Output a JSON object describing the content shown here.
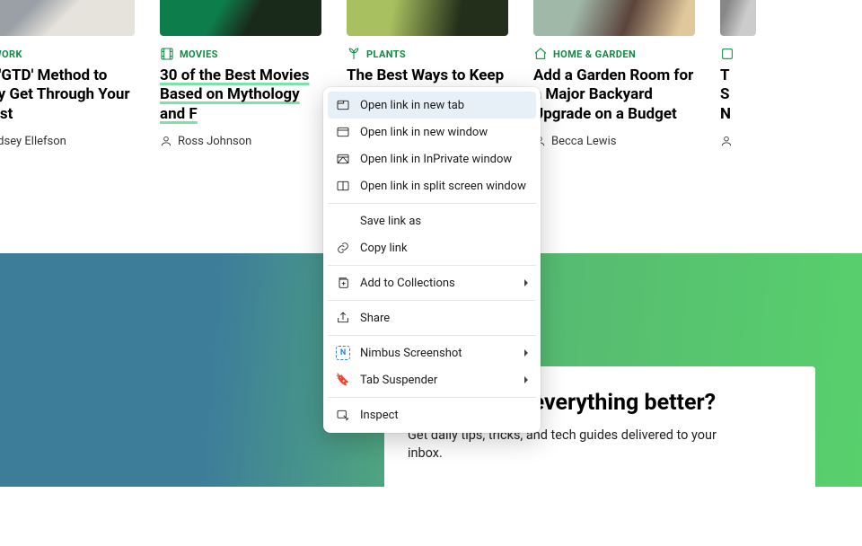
{
  "cards": [
    {
      "category": "WORK",
      "title": "the 'GTD' Method to ually Get Through Your To-ist",
      "author": "ndsey Ellefson",
      "underline": false
    },
    {
      "category": "MOVIES",
      "title": "30 of the Best Movies Based on Mythology and F",
      "author": "Ross Johnson",
      "underline": true
    },
    {
      "category": "PLANTS",
      "title": "The Best Ways to Keep                                       r Potted",
      "author": "",
      "underline": false
    },
    {
      "category": "HOME & GARDEN",
      "title": "Add a Garden Room for a Major Backyard Upgrade on a Budget",
      "author": "Becca Lewis",
      "underline": false
    },
    {
      "category": "",
      "title": "T\nS\nN",
      "author": "",
      "underline": false
    }
  ],
  "subscribe": {
    "title": "Ready to do everything better?",
    "sub": "Get daily tips, tricks, and tech guides delivered to your inbox."
  },
  "context_menu": {
    "items": [
      {
        "id": "open-new-tab",
        "label": "Open link in new tab",
        "hover": true,
        "icon": "tab",
        "submenu": false
      },
      {
        "id": "open-new-window",
        "label": "Open link in new window",
        "hover": false,
        "icon": "window",
        "submenu": false
      },
      {
        "id": "open-inprivate",
        "label": "Open link in InPrivate window",
        "hover": false,
        "icon": "inprivate",
        "submenu": false
      },
      {
        "id": "open-split",
        "label": "Open link in split screen window",
        "hover": false,
        "icon": "split",
        "submenu": false
      },
      {
        "sep": true
      },
      {
        "id": "save-link-as",
        "label": "Save link as",
        "hover": false,
        "icon": "",
        "submenu": false
      },
      {
        "id": "copy-link",
        "label": "Copy link",
        "hover": false,
        "icon": "link",
        "submenu": false
      },
      {
        "sep": true
      },
      {
        "id": "add-collections",
        "label": "Add to Collections",
        "hover": false,
        "icon": "collections",
        "submenu": true
      },
      {
        "sep": true
      },
      {
        "id": "share",
        "label": "Share",
        "hover": false,
        "icon": "share",
        "submenu": false
      },
      {
        "sep": true
      },
      {
        "id": "nimbus",
        "label": "Nimbus Screenshot",
        "hover": false,
        "icon": "nimbus",
        "submenu": true
      },
      {
        "id": "tab-suspender",
        "label": "Tab Suspender",
        "hover": false,
        "icon": "suspender",
        "submenu": true
      },
      {
        "sep": true
      },
      {
        "id": "inspect",
        "label": "Inspect",
        "hover": false,
        "icon": "inspect",
        "submenu": false
      }
    ]
  }
}
